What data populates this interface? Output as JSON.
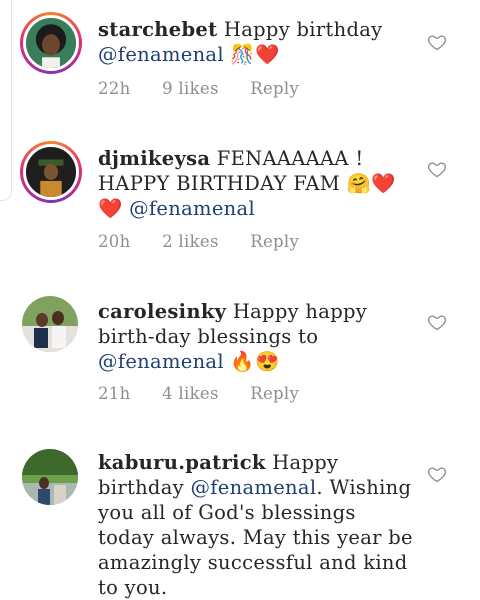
{
  "comments": [
    {
      "username": "starchebet",
      "text": "Happy birthday",
      "mention": "@fenamenal",
      "trailing": " 🎊❤️",
      "time": "22h",
      "likes": "9 likes",
      "reply": "Reply"
    },
    {
      "username": "djmikeysa",
      "text": "FENAAAAAA ! HAPPY BIRTHDAY FAM 🤗❤️ ❤️",
      "mention": "@fenamenal",
      "trailing": "",
      "time": "20h",
      "likes": "2 likes",
      "reply": "Reply"
    },
    {
      "username": "carolesinky",
      "text": "Happy happy birth-day blessings to",
      "mention": "@fenamenal",
      "trailing": " 🔥😍",
      "time": "21h",
      "likes": "4 likes",
      "reply": "Reply"
    },
    {
      "username": "kaburu.patrick",
      "text": "Happy birthday",
      "mention": "@fenamenal",
      "trailing": ". Wishing you all of God's blessings today always. May this year be amazingly successful and kind to you.",
      "time": "",
      "likes": "",
      "reply": ""
    }
  ],
  "icons": {
    "like": "heart-outline-icon"
  },
  "colors": {
    "mention": "#1e3f73",
    "meta": "#8e8e8e",
    "text": "#262626"
  }
}
